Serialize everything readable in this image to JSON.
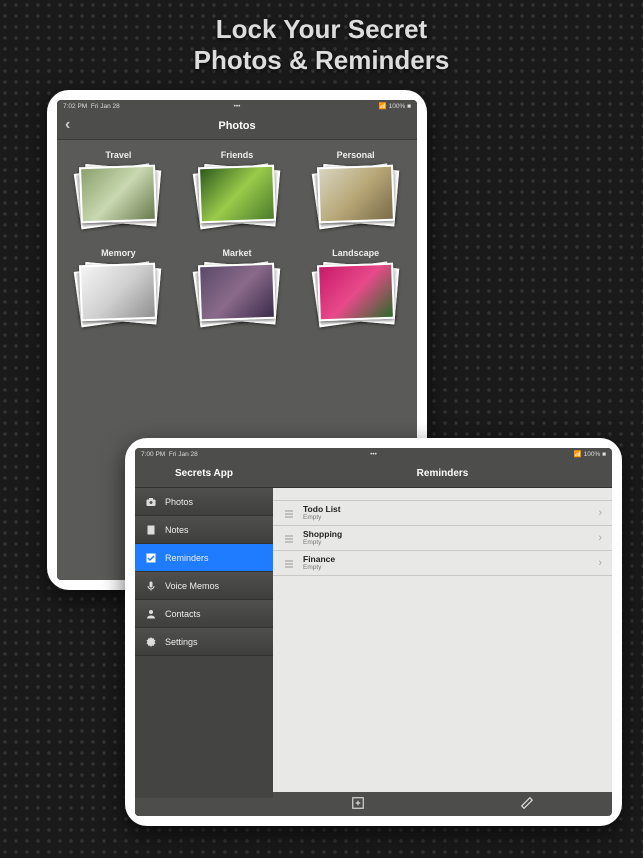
{
  "marketing": {
    "line1": "Lock Your Secret",
    "line2": "Photos & Reminders"
  },
  "status_a": {
    "time": "7:02 PM",
    "date": "Fri Jan 28",
    "battery": "100%"
  },
  "status_b": {
    "time": "7:00 PM",
    "date": "Fri Jan 28",
    "battery": "100%"
  },
  "photos_screen": {
    "title": "Photos",
    "albums": [
      {
        "label": "Travel"
      },
      {
        "label": "Friends"
      },
      {
        "label": "Personal"
      },
      {
        "label": "Memory"
      },
      {
        "label": "Market"
      },
      {
        "label": "Landscape"
      }
    ]
  },
  "reminders_screen": {
    "sidebar_title": "Secrets App",
    "main_title": "Reminders",
    "sidebar": [
      {
        "label": "Photos",
        "icon": "camera"
      },
      {
        "label": "Notes",
        "icon": "note"
      },
      {
        "label": "Reminders",
        "icon": "check",
        "selected": true
      },
      {
        "label": "Voice Memos",
        "icon": "mic"
      },
      {
        "label": "Contacts",
        "icon": "contact"
      },
      {
        "label": "Settings",
        "icon": "gear"
      }
    ],
    "lists": [
      {
        "title": "Todo List",
        "sub": "Empty"
      },
      {
        "title": "Shopping",
        "sub": "Empty"
      },
      {
        "title": "Finance",
        "sub": "Empty"
      }
    ]
  },
  "thumb_colors": [
    [
      "#8aa06c",
      "#c9d8b0",
      "#6a7a4e"
    ],
    [
      "#2e5a1e",
      "#9acb4a",
      "#4a7a2a"
    ],
    [
      "#d8d4c0",
      "#b8a878",
      "#7a6a48"
    ],
    [
      "#f4f4f4",
      "#d0d0d0",
      "#909090"
    ],
    [
      "#5a4a6a",
      "#8a6a8a",
      "#3a2a4a"
    ],
    [
      "#c81a6a",
      "#e84a8a",
      "#2a6a2a"
    ]
  ]
}
